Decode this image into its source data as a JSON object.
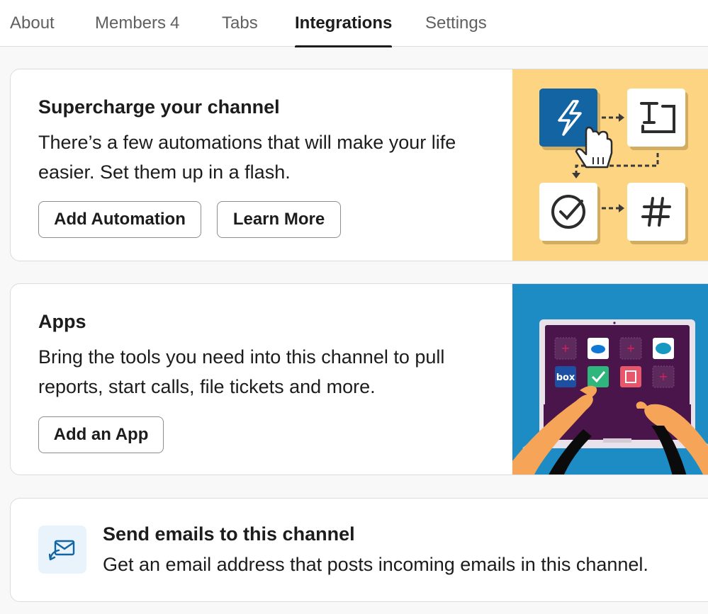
{
  "tabs": [
    {
      "label": "About"
    },
    {
      "label": "Members",
      "count": "4"
    },
    {
      "label": "Tabs"
    },
    {
      "label": "Integrations",
      "active": true
    },
    {
      "label": "Settings"
    }
  ],
  "automation_card": {
    "title": "Supercharge your channel",
    "description": "There’s a few automations that will make your life easier. Set them up in a flash.",
    "primary_button": "Add Automation",
    "secondary_button": "Learn More",
    "illustration_bg": "#fdd582",
    "accent": "#1264a3"
  },
  "apps_card": {
    "title": "Apps",
    "description": "Bring the tools you need into this channel to pull reports, start calls, file tickets and more.",
    "button": "Add an App",
    "illustration_bg": "#1d8cc5",
    "app_icons": [
      {
        "label": "box"
      },
      {
        "label": "salesforce"
      }
    ]
  },
  "email_card": {
    "title": "Send emails to this channel",
    "description": "Get an email address that posts incoming emails in this channel.",
    "icon": "email-forward-icon"
  }
}
